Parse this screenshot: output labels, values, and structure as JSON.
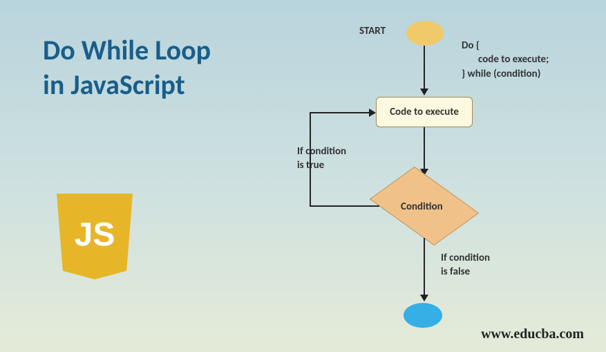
{
  "title_line1": "Do While Loop",
  "title_line2": "in JavaScript",
  "logo_text": "JS",
  "flow": {
    "start_label": "START",
    "syntax_l1": "Do {",
    "syntax_l2": "code to execute;",
    "syntax_l3": "} while (condition)",
    "code_box": "Code to execute",
    "condition": "Condition",
    "true_label_l1": "If condition",
    "true_label_l2": "is true",
    "false_label_l1": "If condition",
    "false_label_l2": "is false"
  },
  "website": "www.educba.com"
}
